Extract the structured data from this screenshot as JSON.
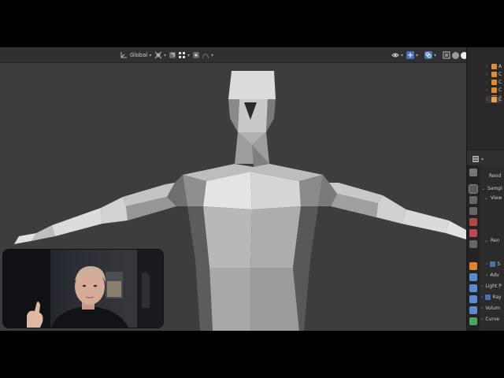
{
  "viewport_header": {
    "transform_orientation": "Global",
    "icons": [
      "orientation-icon",
      "transform-pivot-icon",
      "snap-icon",
      "snap-increment-icon",
      "proportional-edit-icon",
      "proportional-falloff-icon",
      "view-object-types-icon",
      "gizmo-icon",
      "overlays-icon",
      "xray-icon",
      "wireframe-shading-icon",
      "solid-shading-icon",
      "material-shading-icon",
      "rendered-shading-icon"
    ]
  },
  "outliner": {
    "items": [
      "A",
      "C",
      "C",
      "C",
      "C",
      "C"
    ]
  },
  "properties": {
    "header_label": "Rend",
    "rows": [
      {
        "label": "Sampl",
        "expanded": true
      },
      {
        "label": "View",
        "expanded": true
      },
      {
        "label": "Ren",
        "expanded": true
      },
      {
        "label": "S",
        "checked": true
      },
      {
        "label": "Adv",
        "expanded": false
      },
      {
        "label": "Light P",
        "expanded": false
      },
      {
        "label": "Ray",
        "checked": true
      },
      {
        "label": "Volum",
        "expanded": false
      },
      {
        "label": "Curve",
        "expanded": false
      }
    ]
  },
  "colors": {
    "viewport_bg": "#3d3d3d",
    "header_bg": "#303030",
    "panel_bg": "#2b2b2b",
    "accent_blue": "#4772b3",
    "mesh_light": "#dcdcdc",
    "mesh_mid": "#a6a6a6",
    "mesh_dark": "#5c5c5c"
  }
}
